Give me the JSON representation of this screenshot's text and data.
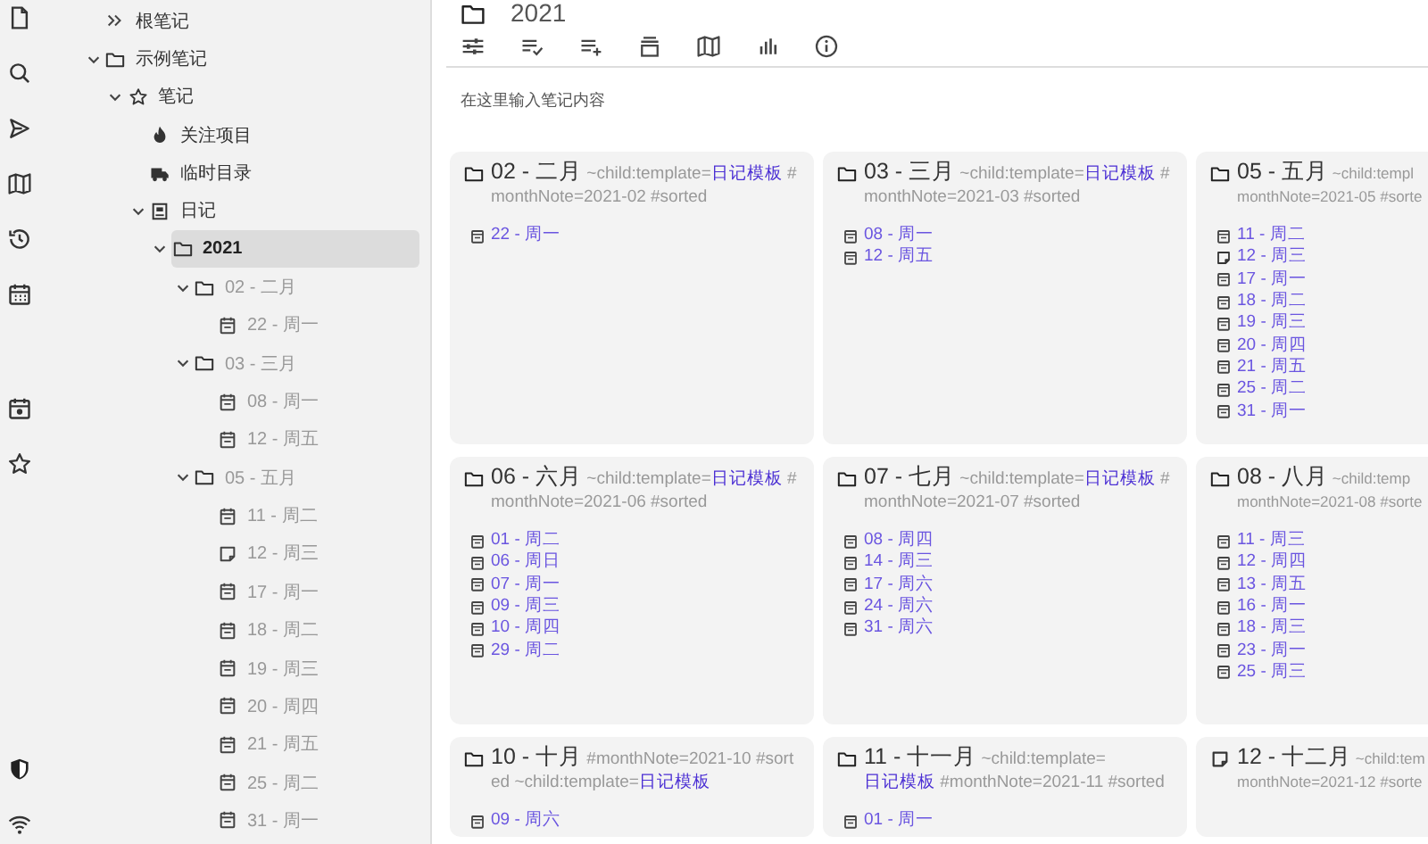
{
  "tree": [
    {
      "kind": "root",
      "label": "根笔记",
      "selected": false,
      "dimmed": false
    },
    {
      "kind": "folder",
      "label": "示例笔记",
      "selected": false,
      "dimmed": false,
      "expanded": true,
      "children": [
        {
          "kind": "star",
          "label": "笔记",
          "selected": false,
          "dimmed": false,
          "expanded": true,
          "children": [
            {
              "kind": "flame",
              "label": "关注项目",
              "selected": false,
              "dimmed": false
            },
            {
              "kind": "truck",
              "label": "临时目录",
              "selected": false,
              "dimmed": false
            },
            {
              "kind": "book",
              "label": "日记",
              "selected": false,
              "dimmed": false,
              "expanded": true,
              "children": [
                {
                  "kind": "folder",
                  "label": "2021",
                  "selected": true,
                  "dimmed": false,
                  "expanded": true,
                  "children": [
                    {
                      "kind": "folder",
                      "label": "02 - 二月",
                      "selected": false,
                      "dimmed": true,
                      "expanded": true,
                      "children": [
                        {
                          "kind": "day",
                          "label": "22 - 周一",
                          "selected": false,
                          "dimmed": true
                        }
                      ]
                    },
                    {
                      "kind": "folder",
                      "label": "03 - 三月",
                      "selected": false,
                      "dimmed": true,
                      "expanded": true,
                      "children": [
                        {
                          "kind": "day",
                          "label": "08 - 周一",
                          "selected": false,
                          "dimmed": true
                        },
                        {
                          "kind": "day",
                          "label": "12 - 周五",
                          "selected": false,
                          "dimmed": true
                        }
                      ]
                    },
                    {
                      "kind": "folder",
                      "label": "05 - 五月",
                      "selected": false,
                      "dimmed": true,
                      "expanded": true,
                      "children": [
                        {
                          "kind": "day",
                          "label": "11 - 周二",
                          "selected": false,
                          "dimmed": true
                        },
                        {
                          "kind": "note",
                          "label": "12 - 周三",
                          "selected": false,
                          "dimmed": true
                        },
                        {
                          "kind": "day",
                          "label": "17 - 周一",
                          "selected": false,
                          "dimmed": true
                        },
                        {
                          "kind": "day",
                          "label": "18 - 周二",
                          "selected": false,
                          "dimmed": true
                        },
                        {
                          "kind": "day",
                          "label": "19 - 周三",
                          "selected": false,
                          "dimmed": true
                        },
                        {
                          "kind": "day",
                          "label": "20 - 周四",
                          "selected": false,
                          "dimmed": true
                        },
                        {
                          "kind": "day",
                          "label": "21 - 周五",
                          "selected": false,
                          "dimmed": true
                        },
                        {
                          "kind": "day",
                          "label": "25 - 周二",
                          "selected": false,
                          "dimmed": true
                        },
                        {
                          "kind": "day",
                          "label": "31 - 周一",
                          "selected": false,
                          "dimmed": true
                        }
                      ]
                    }
                  ]
                }
              ]
            }
          ]
        }
      ]
    }
  ],
  "note": {
    "title": "2021",
    "placeholder": "在这里输入笔记内容"
  },
  "cards": [
    {
      "kind": "folder",
      "title": "02 - 二月",
      "attributes": [
        {
          "kind": "text",
          "text": "~child:template="
        },
        {
          "kind": "link",
          "text": "日记模板"
        },
        {
          "kind": "text",
          "text": " #monthNote=2021-02 #sorted"
        }
      ],
      "items": [
        {
          "kind": "day",
          "label": "22 - 周一"
        }
      ]
    },
    {
      "kind": "folder",
      "title": "03 - 三月",
      "attributes": [
        {
          "kind": "text",
          "text": "~child:template="
        },
        {
          "kind": "link",
          "text": "日记模板"
        },
        {
          "kind": "text",
          "text": " #monthNote=2021-03 #sorted"
        }
      ],
      "items": [
        {
          "kind": "day",
          "label": "08 - 周一"
        },
        {
          "kind": "day",
          "label": "12 - 周五"
        }
      ]
    },
    {
      "kind": "folder",
      "title": "05 - 五月",
      "attributes": [
        {
          "kind": "text",
          "text": "~child:templ"
        },
        {
          "kind": "line",
          "text": "monthNote=2021-05 #sorte"
        }
      ],
      "items": [
        {
          "kind": "day",
          "label": "11 - 周二"
        },
        {
          "kind": "note",
          "label": "12 - 周三"
        },
        {
          "kind": "day",
          "label": "17 - 周一"
        },
        {
          "kind": "day",
          "label": "18 - 周二"
        },
        {
          "kind": "day",
          "label": "19 - 周三"
        },
        {
          "kind": "day",
          "label": "20 - 周四"
        },
        {
          "kind": "day",
          "label": "21 - 周五"
        },
        {
          "kind": "day",
          "label": "25 - 周二"
        },
        {
          "kind": "day",
          "label": "31 - 周一"
        }
      ]
    },
    {
      "kind": "folder",
      "title": "06 - 六月",
      "attributes": [
        {
          "kind": "text",
          "text": "~child:template="
        },
        {
          "kind": "link",
          "text": "日记模板"
        },
        {
          "kind": "text",
          "text": " #monthNote=2021-06 #sorted"
        }
      ],
      "items": [
        {
          "kind": "day",
          "label": "01 - 周二"
        },
        {
          "kind": "day",
          "label": "06 - 周日"
        },
        {
          "kind": "day",
          "label": "07 - 周一"
        },
        {
          "kind": "day",
          "label": "09 - 周三"
        },
        {
          "kind": "day",
          "label": "10 - 周四"
        },
        {
          "kind": "day",
          "label": "29 - 周二"
        }
      ]
    },
    {
      "kind": "folder",
      "title": "07 - 七月",
      "attributes": [
        {
          "kind": "text",
          "text": "~child:template="
        },
        {
          "kind": "link",
          "text": "日记模板"
        },
        {
          "kind": "text",
          "text": " #monthNote=2021-07 #sorted"
        }
      ],
      "items": [
        {
          "kind": "day",
          "label": "08 - 周四"
        },
        {
          "kind": "day",
          "label": "14 - 周三"
        },
        {
          "kind": "day",
          "label": "17 - 周六"
        },
        {
          "kind": "day",
          "label": "24 - 周六"
        },
        {
          "kind": "day",
          "label": "31 - 周六"
        }
      ]
    },
    {
      "kind": "folder",
      "title": "08 - 八月",
      "attributes": [
        {
          "kind": "text",
          "text": "~child:temp"
        },
        {
          "kind": "line",
          "text": "monthNote=2021-08 #sorte"
        }
      ],
      "items": [
        {
          "kind": "day",
          "label": "11 - 周三"
        },
        {
          "kind": "day",
          "label": "12 - 周四"
        },
        {
          "kind": "day",
          "label": "13 - 周五"
        },
        {
          "kind": "day",
          "label": "16 - 周一"
        },
        {
          "kind": "day",
          "label": "18 - 周三"
        },
        {
          "kind": "day",
          "label": "23 - 周一"
        },
        {
          "kind": "day",
          "label": "25 - 周三"
        }
      ]
    },
    {
      "kind": "folder",
      "title": "10 - 十月",
      "attributes": [
        {
          "kind": "text",
          "text": "#monthNote=2021-10 #sorted ~child:template="
        },
        {
          "kind": "link",
          "text": "日记模板"
        }
      ],
      "items": [
        {
          "kind": "day",
          "label": "09 - 周六"
        }
      ]
    },
    {
      "kind": "folder",
      "title": "11 - 十一月",
      "attributes": [
        {
          "kind": "text",
          "text": "~child:template="
        },
        {
          "kind": "link",
          "text": "日记模板"
        },
        {
          "kind": "text",
          "text": " #monthNote=2021-11 #sorted"
        }
      ],
      "items": [
        {
          "kind": "day",
          "label": "01 - 周一"
        }
      ]
    },
    {
      "kind": "note",
      "title": "12 - 十二月",
      "attributes": [
        {
          "kind": "text",
          "text": "~child:tem"
        },
        {
          "kind": "line",
          "text": "monthNote=2021-12 #sorte"
        }
      ]
    }
  ]
}
